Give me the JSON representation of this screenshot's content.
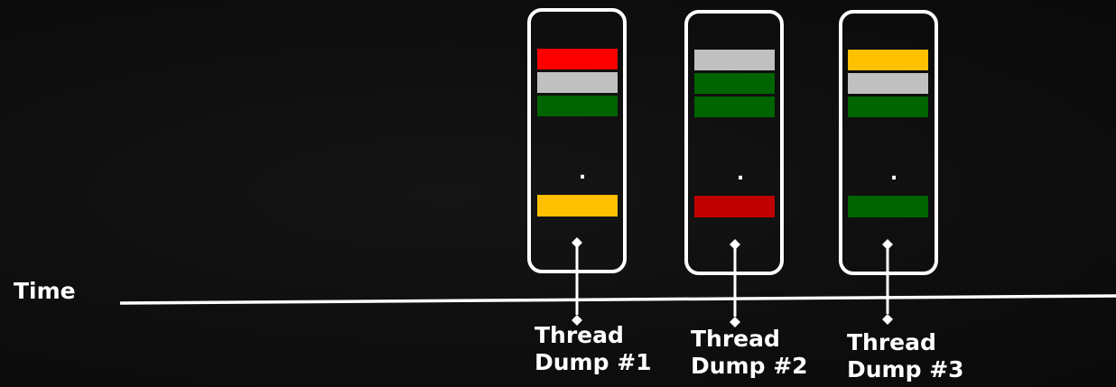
{
  "time_label": "Time",
  "dump_dot": ".",
  "dumps": [
    {
      "label_line1": "Thread",
      "label_line2": "Dump #1",
      "stack_top": [
        "#ff0000",
        "#c0c0c0",
        "#006400"
      ],
      "stack_bottom": "#ffc000"
    },
    {
      "label_line1": "Thread",
      "label_line2": "Dump #2",
      "stack_top": [
        "#c0c0c0",
        "#006400",
        "#006400"
      ],
      "stack_bottom": "#c00000"
    },
    {
      "label_line1": "Thread",
      "label_line2": "Dump #3",
      "stack_top": [
        "#ffc000",
        "#c0c0c0",
        "#006400"
      ],
      "stack_bottom": "#006400"
    }
  ]
}
